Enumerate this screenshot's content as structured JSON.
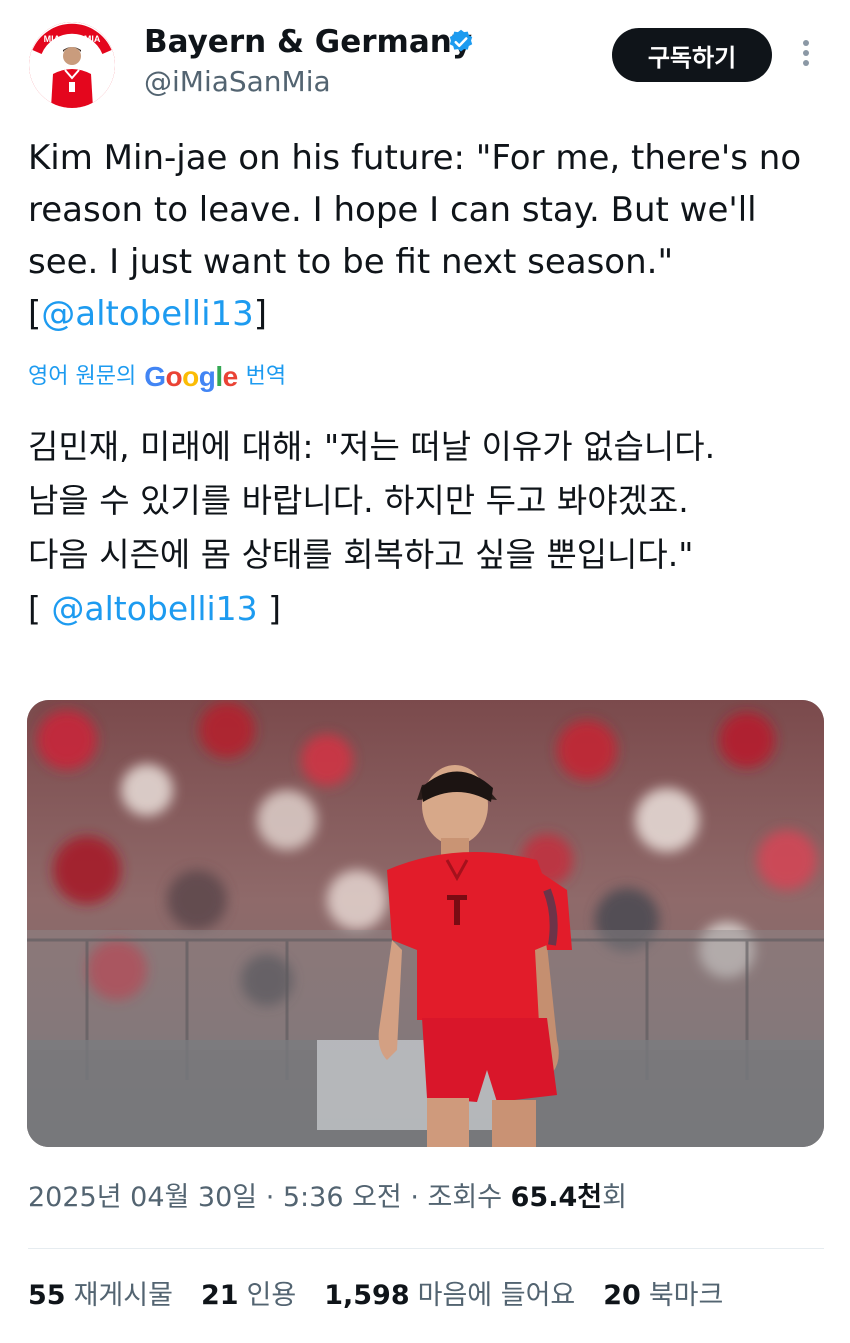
{
  "author": {
    "display_name": "Bayern & Germany",
    "handle": "@iMiaSanMia",
    "verified": true,
    "avatar_icon": "avatar-player-in-red-kit",
    "avatar_text": "MIA SAN MIA"
  },
  "actions": {
    "subscribe_label": "구독하기",
    "more_icon": "more-vertical-icon"
  },
  "tweet": {
    "text_before_mention": "Kim Min-jae on his future: \"For me, there's no reason to leave. I hope I can stay. But we'll see. I just want to be fit next season.\"",
    "bracket_open": "[",
    "mention": "@altobelli13",
    "bracket_close": "]"
  },
  "translation": {
    "prefix": "영어 원문의",
    "provider": "Google",
    "suffix": "번역",
    "lines": [
      "김민재, 미래에 대해: \"저는 떠날 이유가 없습니다.",
      "남을 수 있기를 바랍니다. 하지만 두고 봐야겠죠.",
      "다음 시즌에 몸 상태를 회복하고 싶을 뿐입니다.\""
    ],
    "bracket_open": "[ ",
    "mention": "@altobelli13",
    "bracket_close": " ]"
  },
  "media": {
    "kind": "photo",
    "description_icon": "football-player-photo"
  },
  "meta": {
    "date": "2025년 04월 30일",
    "separator": " · ",
    "time": "5:36 오전",
    "views_label": "조회수 ",
    "views_count": "65.4천",
    "views_suffix": "회"
  },
  "stats": {
    "retweets_num": "55",
    "retweets_label": "재게시물",
    "quotes_num": "21",
    "quotes_label": "인용",
    "likes_num": "1,598",
    "likes_label": "마음에 들어요",
    "bookmarks_num": "20",
    "bookmarks_label": "북마크"
  },
  "colors": {
    "link": "#1d9bf0",
    "text": "#0f1419",
    "muted": "#536471",
    "button_bg": "#0f1419",
    "verified": "#1d9bf0",
    "bayern_red": "#e4061d"
  }
}
